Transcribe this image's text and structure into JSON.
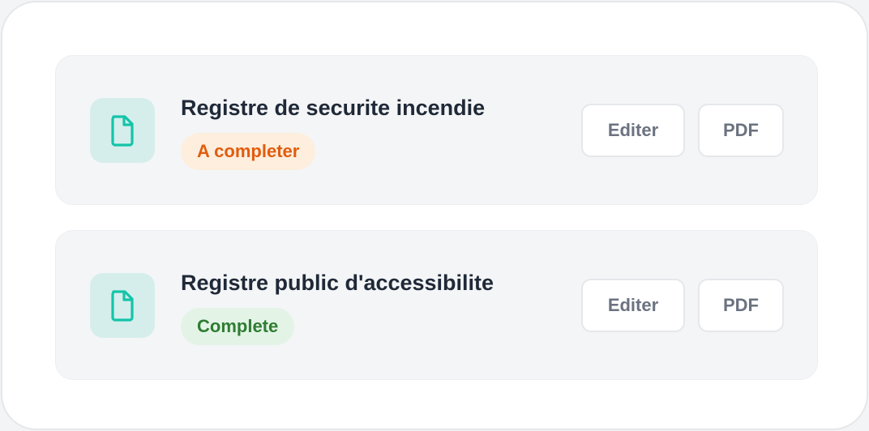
{
  "colors": {
    "icon_tile_bg": "#d5eeec",
    "icon_stroke": "#14c4a8",
    "pending_badge_bg": "#fdeedd",
    "pending_badge_text": "#e25c0e",
    "complete_badge_bg": "#e3f4e6",
    "complete_badge_text": "#2e7d32"
  },
  "documents": [
    {
      "title": "Registre de securite incendie",
      "icon": "document-icon",
      "status": {
        "label": "A completer",
        "kind": "pending"
      },
      "edit_label": "Editer",
      "pdf_label": "PDF"
    },
    {
      "title": "Registre public d'accessibilite",
      "icon": "document-icon",
      "status": {
        "label": "Complete",
        "kind": "complete"
      },
      "edit_label": "Editer",
      "pdf_label": "PDF"
    }
  ]
}
